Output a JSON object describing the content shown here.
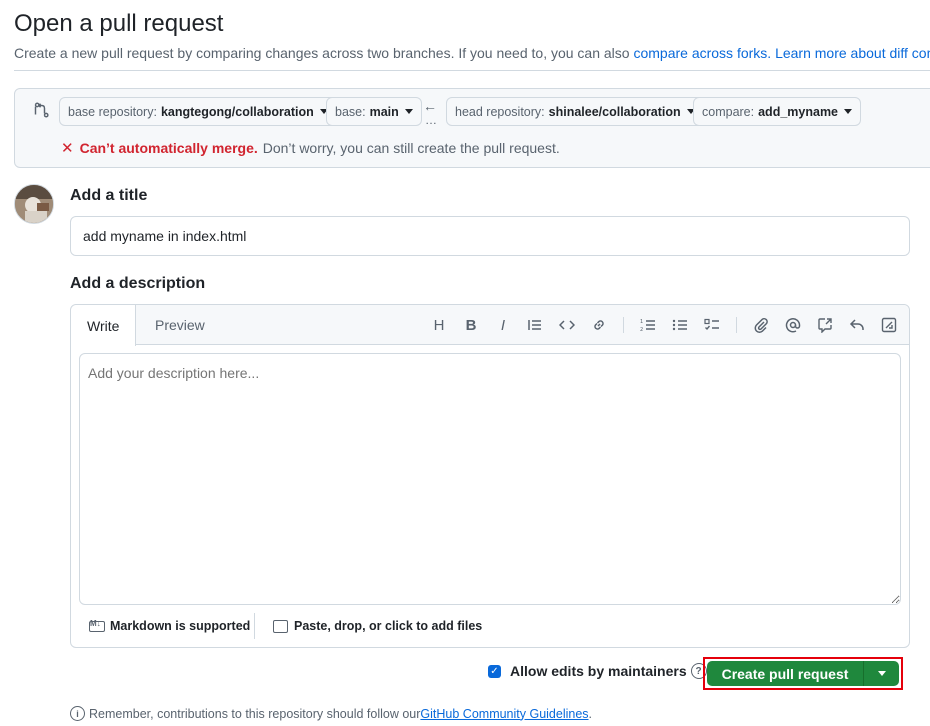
{
  "header": {
    "title": "Open a pull request",
    "subtitle_text": "Create a new pull request by comparing changes across two branches. If you need to, you can also ",
    "compare_forks_link": "compare across forks.",
    "learn_more_link": "Learn more about diff comparisons here."
  },
  "compare": {
    "base_repo_label": "base repository:",
    "base_repo_value": "kangtegong/collaboration",
    "base_label": "base:",
    "base_value": "main",
    "head_repo_label": "head repository:",
    "head_repo_value": "shinalee/collaboration",
    "compare_label": "compare:",
    "compare_value": "add_myname",
    "arrow": "←",
    "dots": "…",
    "merge_fail": "Can’t automatically merge.",
    "merge_note": "Don’t worry, you can still create the pull request."
  },
  "form": {
    "title_label": "Add a title",
    "title_value": "add myname in index.html",
    "description_label": "Add a description",
    "tab_write": "Write",
    "tab_preview": "Preview",
    "description_placeholder": "Add your description here...",
    "markdown_note": "Markdown is supported",
    "attach_note": "Paste, drop, or click to add files"
  },
  "toolbar": {
    "heading": "H",
    "bold": "B",
    "italic": "I"
  },
  "actions": {
    "allow_edits": "Allow edits by maintainers",
    "help": "?",
    "create_label": "Create pull request"
  },
  "reminder": {
    "text": "Remember, contributions to this repository should follow our ",
    "link": "GitHub Community Guidelines",
    "end": "."
  },
  "colors": {
    "primary_green": "#1f883d",
    "link_blue": "#0969da",
    "error_red": "#d1242f",
    "highlight_border": "#e5000b"
  }
}
